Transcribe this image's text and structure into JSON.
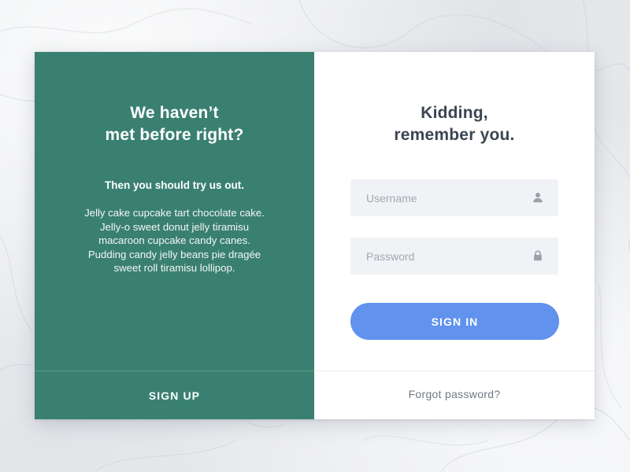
{
  "signup_panel": {
    "heading_lines": [
      "We haven’t",
      "met before right?"
    ],
    "subheading": "Then you should try us out.",
    "body": "Jelly cake cupcake tart chocolate cake. Jelly-o sweet donut jelly tiramisu macaroon cupcake candy canes. Pudding candy jelly beans pie dragée sweet roll tiramisu lollipop.",
    "signup_label": "SIGN UP",
    "background_color": "#3a8070"
  },
  "signin_panel": {
    "heading_lines": [
      "Kidding,",
      "remember you."
    ],
    "username": {
      "placeholder": "Username",
      "value": "",
      "icon": "user-icon"
    },
    "password": {
      "placeholder": "Password",
      "value": "",
      "icon": "lock-icon"
    },
    "signin_label": "SIGN IN",
    "signin_color": "#6092ee",
    "forgot_label": "Forgot password?"
  }
}
